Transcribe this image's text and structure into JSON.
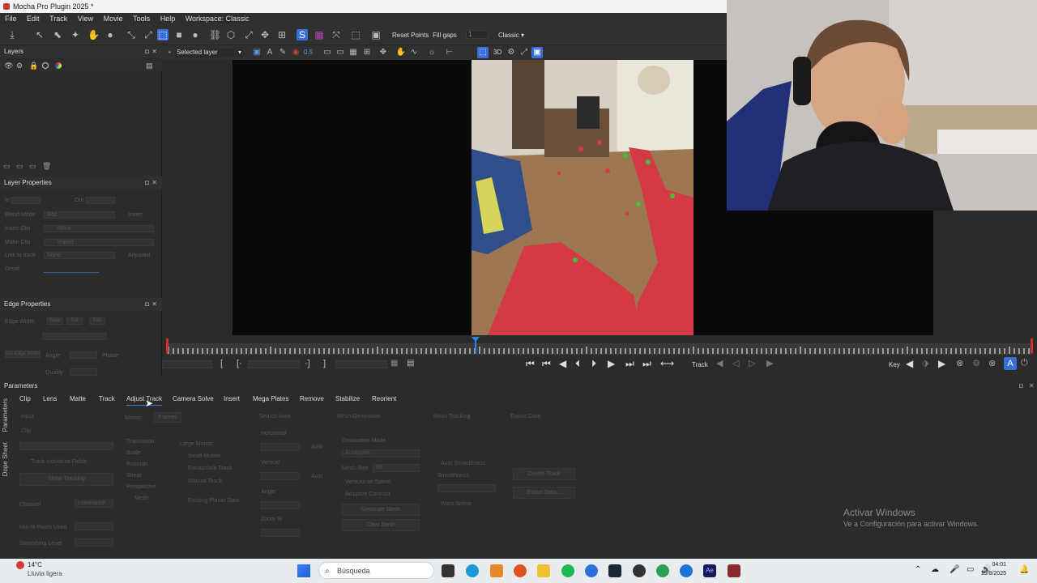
{
  "window": {
    "title": "Mocha Pro Plugin 2025 *"
  },
  "menu": [
    "File",
    "Edit",
    "Track",
    "View",
    "Movie",
    "Tools",
    "Help",
    "Workspace: Classic"
  ],
  "toolbar": {
    "reset_points": "Reset Points",
    "fill_gaps": "Fill gaps",
    "fill_value": "1",
    "workspace": "Classic"
  },
  "viewer_toolbar": {
    "layer_select": "Selected layer",
    "opacity": "0.5",
    "view_3d": "3D"
  },
  "layers_panel": {
    "title": "Layers"
  },
  "layer_properties": {
    "title": "Layer Properties",
    "in_label": "In",
    "out_label": "Out",
    "blend_mode_label": "Blend Mode",
    "blend_mode": "Add",
    "invert_label": "Invert",
    "insert_clip_label": "Insert Clip",
    "insert_clip": "None",
    "matte_clip_label": "Matte Clip",
    "matte_clip": "Import",
    "link_label": "Link to track",
    "link": "None",
    "adjusted_label": "Adjusted",
    "detail_label": "Detail"
  },
  "edge_properties": {
    "title": "Edge Properties",
    "edge_width_label": "Edge Width",
    "angle_label": "Angle",
    "phase_label": "Phase",
    "quality_label": "Quality",
    "buttons": [
      "Bake",
      "Set",
      "Edit"
    ],
    "edge_button": "Set Edge Width"
  },
  "transport": {
    "track_label": "Track",
    "key_label": "Key"
  },
  "params": {
    "title": "Parameters",
    "tabs": [
      "Clip",
      "Lens",
      "Matte",
      "Track",
      "Adjust Track",
      "Camera Solve",
      "Insert",
      "Mega Plates",
      "Remove",
      "Stabilize",
      "Reorient"
    ],
    "active_tab": "Adjust Track",
    "side_tabs": [
      "Parameters",
      "Dope Sheet"
    ],
    "input_label": "Input",
    "clip_label": "Clip",
    "track_individual": "Track Individual Fields",
    "generate_btn": "Show Tracking",
    "channel_label": "Channel",
    "channel_value": "Luminance",
    "min_pixels_label": "Min % Pixels Used",
    "smoothing_label": "Smoothing Level",
    "motion_label": "Motion",
    "frames_label": "Frames",
    "motion_opts": [
      "Translation",
      "Scale",
      "Rotation",
      "Shear",
      "Perspective"
    ],
    "large_motion": "Large Motion",
    "small_motion": "Small Motion",
    "extrapolate": "Extrapolate Track",
    "manual_track": "Manual Track",
    "existing_planar": "Existing Planar Data",
    "mesh": "Mesh",
    "search_area": "Search Area",
    "horizontal": "Horizontal",
    "vertical": "Vertical",
    "angle": "Angle",
    "zoom": "Zoom %",
    "auto1": "Auto",
    "auto2": "Auto",
    "mesh_generation": "Mesh Generation",
    "generation_mode": "Generation Mode",
    "generation_value": "Automatic",
    "mesh_size": "Mesh Size",
    "mesh_size_val": "30",
    "vertices_on_spline": "Vertices on Spline",
    "adaptive_contrast": "Adaptive Contrast",
    "generate_mesh_btn": "Generate Mesh",
    "clear_mesh_btn": "Clear Mesh",
    "mesh_tracking": "Mesh Tracking",
    "auto_smoothness": "Auto Smoothness",
    "smoothness": "Smoothness",
    "warp_spline": "Warp Spline",
    "export_data": "Export Data",
    "export_btn": "Create Track",
    "export_btn2": "Export Data..."
  },
  "watermark": {
    "line1": "Activar Windows",
    "line2": "Ve a Configuración para activar Windows."
  },
  "taskbar": {
    "weather_temp": "14°C",
    "weather_desc": "Lluvia ligera",
    "search_placeholder": "Búsqueda",
    "time": "04:01",
    "date": "19/8/2025"
  },
  "colors": {
    "accent": "#3a7bd5",
    "mask_red": "#d43a45",
    "track_green": "#3cc43c",
    "playhead": "#2b88e6"
  }
}
